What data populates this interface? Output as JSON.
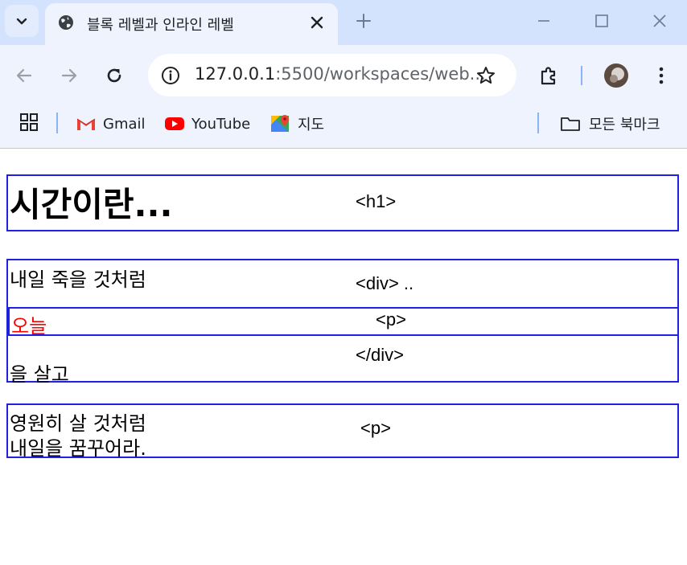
{
  "browser": {
    "tab": {
      "title": "블록 레벨과 인라인 레벨"
    },
    "address": {
      "host": "127.0.0.1",
      "rest": ":5500/workspaces/web..."
    },
    "bookmarks": {
      "items": [
        {
          "label": "Gmail",
          "icon": "gmail-icon"
        },
        {
          "label": "YouTube",
          "icon": "youtube-icon"
        },
        {
          "label": "지도",
          "icon": "maps-icon"
        }
      ],
      "all_bookmarks": "모든 북마크"
    }
  },
  "page": {
    "block1": {
      "heading": "시간이란...",
      "note": "<h1>"
    },
    "block2": {
      "line1": "내일 죽을 것처럼",
      "note_open": "<div>  ..",
      "inner_text": "오늘",
      "inner_note": "<p>",
      "line3": "을 살고",
      "note_close": "</div>"
    },
    "block3": {
      "line1": "영원히 살 것처럼",
      "line2": "내일을 꿈꾸어라.",
      "note": "<p>"
    },
    "colors": {
      "border": "#2020e0",
      "highlight": "#ff0000"
    }
  }
}
